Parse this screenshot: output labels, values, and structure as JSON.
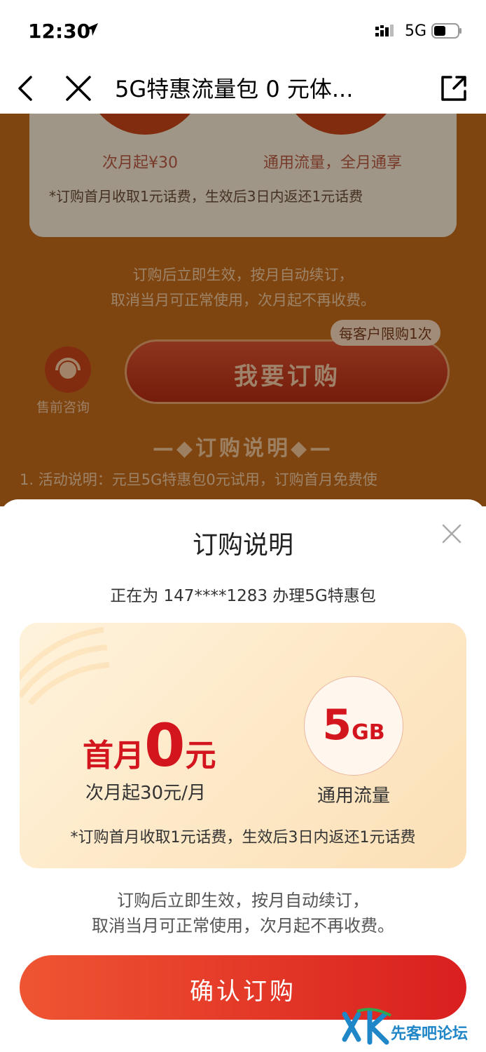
{
  "status_bar": {
    "time": "12:30",
    "network": "5G",
    "icons": [
      "location-arrow-icon",
      "signal-icon",
      "battery-icon"
    ]
  },
  "nav": {
    "title": "5G特惠流量包 0 元体...",
    "icons": [
      "back-icon",
      "close-icon",
      "share-icon"
    ]
  },
  "background_page": {
    "left_price_caption": "次月起¥30",
    "right_caption": "通用流量，全月通享",
    "note": "*订购首月收取1元话费，生效后3日内返还1元话费",
    "info_line1": "订购后立即生效，按月自动续订，",
    "info_line2": "取消当月可正常使用，次月起不再收费。",
    "limit_tag": "每客户限购1次",
    "buy_button": "我要订购",
    "consult_label": "售前咨询",
    "section_title": "—◆订购说明◆—",
    "activity_line": "1. 活动说明：元旦5G特惠包0元试用，订购首月免费使"
  },
  "sheet": {
    "title": "订购说明",
    "subtitle": "正在为 147****1283 办理5G特惠包",
    "offer": {
      "price_prefix": "首月",
      "price_value": "0",
      "price_unit": "元",
      "next_month": "次月起30元/月",
      "data_value": "5",
      "data_unit": "GB",
      "data_label": "通用流量",
      "note": "*订购首月收取1元话费，生效后3日内返还1元话费"
    },
    "info_line1": "订购后立即生效，按月自动续订，",
    "info_line2": "取消当月可正常使用，次月起不再收费。",
    "confirm_button": "确认订购"
  },
  "watermark": {
    "text": "先客吧论坛"
  },
  "colors": {
    "accent_red": "#d3151d",
    "button_gradient_start": "#ef5532",
    "button_gradient_end": "#d91f1f",
    "background_orange": "#c26b1b"
  }
}
